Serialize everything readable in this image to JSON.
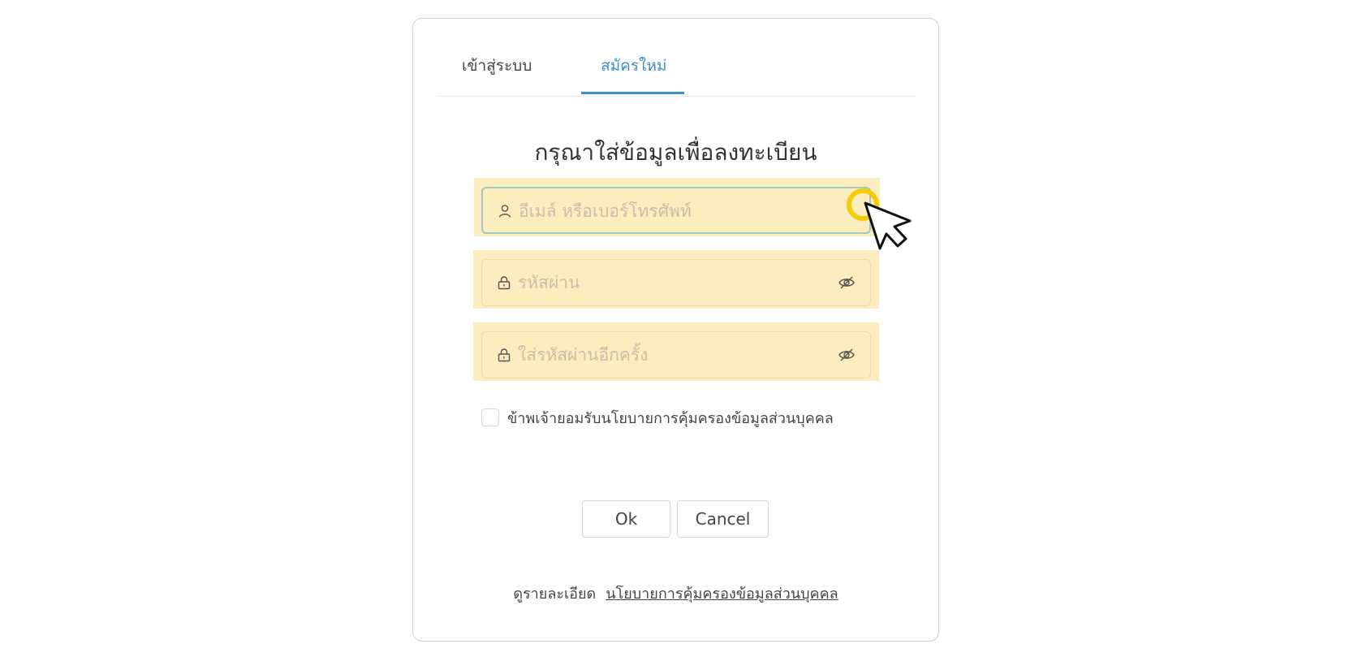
{
  "tabs": {
    "login_label": "เข้าสู่ระบบ",
    "register_label": "สมัครใหม่"
  },
  "heading": "กรุณาใส่ข้อมูลเพื่อลงทะเบียน",
  "fields": {
    "email": {
      "placeholder": "อีเมล์ หรือเบอร์โทรศัพท์",
      "value": "",
      "icon": "user-icon"
    },
    "password": {
      "placeholder": "รหัสผ่าน",
      "value": "",
      "icon": "lock-icon",
      "toggle_icon": "eye-off-icon"
    },
    "confirm_password": {
      "placeholder": "ใส่รหัสผ่านอีกครั้ง",
      "value": "",
      "icon": "lock-icon",
      "toggle_icon": "eye-off-icon"
    }
  },
  "consent": {
    "label": "ข้าพเจ้ายอมรับนโยบายการคุ้มครองข้อมูลส่วนบุคคล",
    "checked": false
  },
  "buttons": {
    "ok_label": "Ok",
    "cancel_label": "Cancel"
  },
  "footer": {
    "prefix": "ดูรายละเอียด",
    "link_label": "นโยบายการคุ้มครองข้อมูลส่วนบุคคล"
  },
  "colors": {
    "accent": "#3a8fd0",
    "highlight": "#fbedbd",
    "pointer_ring": "#f5cc0c"
  }
}
